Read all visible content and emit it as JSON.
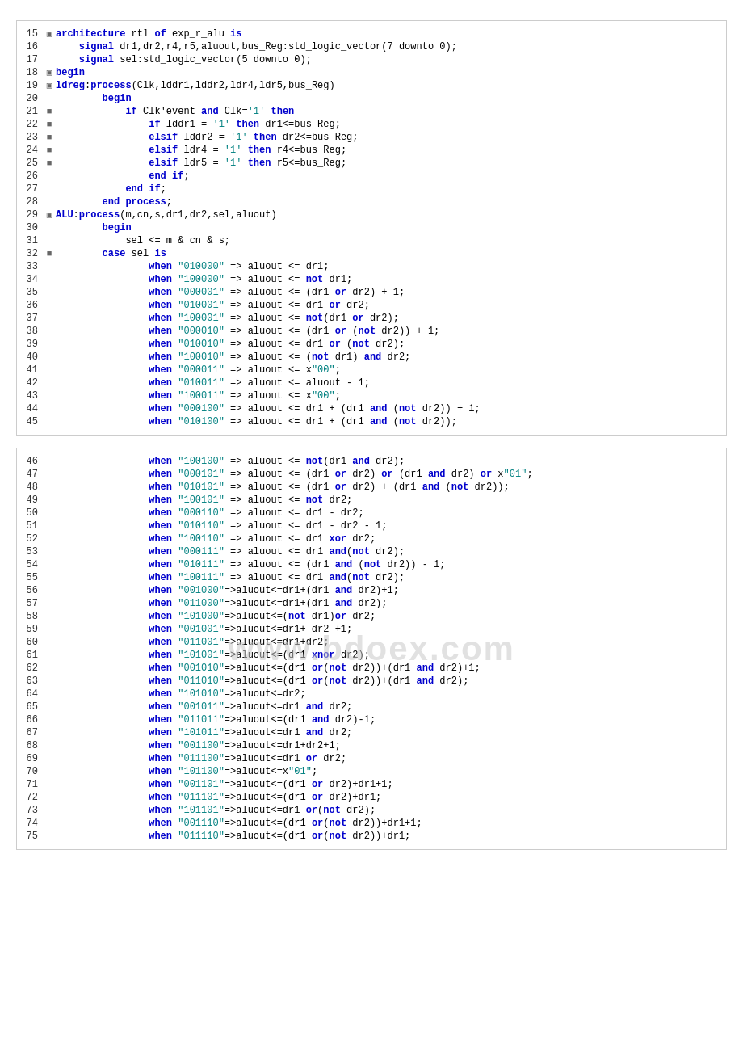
{
  "blocks": {
    "block1": {
      "lines": [
        {
          "num": 15,
          "icon": "▣",
          "content": "architecture rtl of exp_r_alu is"
        },
        {
          "num": 16,
          "icon": "",
          "content": "    signal dr1,dr2,r4,r5,aluout,bus_Reg:std_logic_vector(7 downto 0);"
        },
        {
          "num": 17,
          "icon": "",
          "content": "    signal sel:std_logic_vector(5 downto 0);"
        },
        {
          "num": 18,
          "icon": "▣",
          "content": "begin"
        },
        {
          "num": 19,
          "icon": "▣",
          "content": "ldreg:process(Clk,lddr1,lddr2,ldr4,ldr5,bus_Reg)"
        },
        {
          "num": 20,
          "icon": "",
          "content": "        begin"
        },
        {
          "num": 21,
          "icon": "■",
          "content": "            if Clk'event and Clk='1' then"
        },
        {
          "num": 22,
          "icon": "■",
          "content": "                if lddr1 = '1' then dr1<=bus_Reg;"
        },
        {
          "num": 23,
          "icon": "■",
          "content": "                elsif lddr2 = '1' then dr2<=bus_Reg;"
        },
        {
          "num": 24,
          "icon": "■",
          "content": "                elsif ldr4 = '1' then r4<=bus_Reg;"
        },
        {
          "num": 25,
          "icon": "■",
          "content": "                elsif ldr5 = '1' then r5<=bus_Reg;"
        },
        {
          "num": 26,
          "icon": "",
          "content": "                end if;"
        },
        {
          "num": 27,
          "icon": "",
          "content": "            end if;"
        },
        {
          "num": 28,
          "icon": "",
          "content": "        end process;"
        },
        {
          "num": 29,
          "icon": "▣",
          "content": "ALU:process(m,cn,s,dr1,dr2,sel,aluout)"
        },
        {
          "num": 30,
          "icon": "",
          "content": "        begin"
        },
        {
          "num": 31,
          "icon": "",
          "content": "            sel <= m & cn & s;"
        },
        {
          "num": 32,
          "icon": "■",
          "content": "        case sel is"
        },
        {
          "num": 33,
          "icon": "",
          "content": "                when \"010000\" => aluout <= dr1;"
        },
        {
          "num": 34,
          "icon": "",
          "content": "                when \"100000\" => aluout <= not dr1;"
        },
        {
          "num": 35,
          "icon": "",
          "content": "                when \"000001\" => aluout <= (dr1 or dr2) + 1;"
        },
        {
          "num": 36,
          "icon": "",
          "content": "                when \"010001\" => aluout <= dr1 or dr2;"
        },
        {
          "num": 37,
          "icon": "",
          "content": "                when \"100001\" => aluout <= not(dr1 or dr2);"
        },
        {
          "num": 38,
          "icon": "",
          "content": "                when \"000010\" => aluout <= (dr1 or (not dr2)) + 1;"
        },
        {
          "num": 39,
          "icon": "",
          "content": "                when \"010010\" => aluout <= dr1 or (not dr2);"
        },
        {
          "num": 40,
          "icon": "",
          "content": "                when \"100010\" => aluout <= (not dr1) and dr2;"
        },
        {
          "num": 41,
          "icon": "",
          "content": "                when \"000011\" => aluout <= x\"00\";"
        },
        {
          "num": 42,
          "icon": "",
          "content": "                when \"010011\" => aluout <= aluout - 1;"
        },
        {
          "num": 43,
          "icon": "",
          "content": "                when \"100011\" => aluout <= x\"00\";"
        },
        {
          "num": 44,
          "icon": "",
          "content": "                when \"000100\" => aluout <= dr1 + (dr1 and (not dr2)) + 1;"
        },
        {
          "num": 45,
          "icon": "",
          "content": "                when \"010100\" => aluout <= dr1 + (dr1 and (not dr2));"
        }
      ]
    },
    "block2": {
      "lines": [
        {
          "num": 46,
          "content": "                when \"100100\" => aluout <= not(dr1 and dr2);"
        },
        {
          "num": 47,
          "content": "                when \"000101\" => aluout <= (dr1 or dr2) or (dr1 and dr2) or x\"01\";"
        },
        {
          "num": 48,
          "content": "                when \"010101\" => aluout <= (dr1 or dr2) + (dr1 and (not dr2));"
        },
        {
          "num": 49,
          "content": "                when \"100101\" => aluout <= not dr2;"
        },
        {
          "num": 50,
          "content": "                when \"000110\" => aluout <= dr1 - dr2;"
        },
        {
          "num": 51,
          "content": "                when \"010110\" => aluout <= dr1 - dr2 - 1;"
        },
        {
          "num": 52,
          "content": "                when \"100110\" => aluout <= dr1 xor dr2;"
        },
        {
          "num": 53,
          "content": "                when \"000111\" => aluout <= dr1 and(not dr2);"
        },
        {
          "num": 54,
          "content": "                when \"010111\" => aluout <= (dr1 and (not dr2)) - 1;"
        },
        {
          "num": 55,
          "content": "                when \"100111\" => aluout <= dr1 and(not dr2);"
        },
        {
          "num": 56,
          "content": "                when \"001000\"=>aluout<=dr1+(dr1 and dr2)+1;"
        },
        {
          "num": 57,
          "content": "                when \"011000\"=>aluout<=dr1+(dr1 and dr2);"
        },
        {
          "num": 58,
          "content": "                when \"101000\"=>aluout<=(not dr1)or dr2;"
        },
        {
          "num": 59,
          "content": "                when \"001001\"=>aluout<=dr1+ dr2 +1;"
        },
        {
          "num": 60,
          "content": "                when \"011001\"=>aluout<=dr1+dr2;"
        },
        {
          "num": 61,
          "content": "                when \"101001\"=>aluout<=(dr1 xnor dr2);"
        },
        {
          "num": 62,
          "content": "                when \"001010\"=>aluout<=(dr1 or(not dr2))+(dr1 and dr2)+1;"
        },
        {
          "num": 63,
          "content": "                when \"011010\"=>aluout<=(dr1 or(not dr2))+(dr1 and dr2);"
        },
        {
          "num": 64,
          "content": "                when \"101010\"=>aluout<=dr2;"
        },
        {
          "num": 65,
          "content": "                when \"001011\"=>aluout<=dr1 and dr2;"
        },
        {
          "num": 66,
          "content": "                when \"011011\"=>aluout<=(dr1 and dr2)-1;"
        },
        {
          "num": 67,
          "content": "                when \"101011\"=>aluout<=dr1 and dr2;"
        },
        {
          "num": 68,
          "content": "                when \"001100\"=>aluout<=dr1+dr2+1;"
        },
        {
          "num": 69,
          "content": "                when \"011100\"=>aluout<=dr1 or dr2;"
        },
        {
          "num": 70,
          "content": "                when \"101100\"=>aluout<=x\"01\";"
        },
        {
          "num": 71,
          "content": "                when \"001101\"=>aluout<=(dr1 or dr2)+dr1+1;"
        },
        {
          "num": 72,
          "content": "                when \"011101\"=>aluout<=(dr1 or dr2)+dr1;"
        },
        {
          "num": 73,
          "content": "                when \"101101\"=>aluout<=dr1 or(not dr2);"
        },
        {
          "num": 74,
          "content": "                when \"001110\"=>aluout<=(dr1 or(not dr2))+dr1+1;"
        },
        {
          "num": 75,
          "content": "                when \"011110\"=>aluout<=(dr1 or(not dr2))+dr1;"
        }
      ]
    }
  },
  "watermark": "www.bdoex.com"
}
